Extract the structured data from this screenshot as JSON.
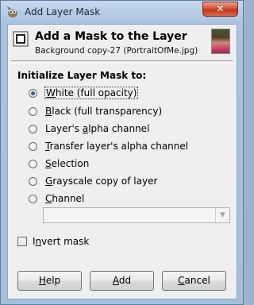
{
  "window": {
    "title": "Add Layer Mask",
    "close_label": "✕",
    "app_icon": "gimp-icon"
  },
  "header": {
    "title": "Add a Mask to the Layer",
    "subtitle": "Background copy-27 (PortraitOfMe.jpg)",
    "icon": "layer-mask-icon",
    "thumbnail": "layer-thumbnail"
  },
  "init_group": {
    "label": "Initialize Layer Mask to:",
    "options": [
      {
        "mnemonic": "W",
        "rest": "hite (full opacity)",
        "selected": true
      },
      {
        "mnemonic": "B",
        "rest": "lack (full transparency)",
        "selected": false
      },
      {
        "pre": "Layer's ",
        "mnemonic": "a",
        "rest": "lpha channel",
        "selected": false
      },
      {
        "mnemonic": "T",
        "rest": "ransfer layer's alpha channel",
        "selected": false
      },
      {
        "mnemonic": "S",
        "rest": "election",
        "selected": false
      },
      {
        "mnemonic": "G",
        "rest": "rayscale copy of layer",
        "selected": false
      },
      {
        "mnemonic": "C",
        "rest": "hannel",
        "selected": false
      }
    ],
    "channel_select": {
      "value": "",
      "enabled": false
    }
  },
  "invert": {
    "pre": "I",
    "mnemonic": "n",
    "rest": "vert mask",
    "checked": false
  },
  "buttons": {
    "help": {
      "mnemonic": "H",
      "rest": "elp"
    },
    "add": {
      "mnemonic": "A",
      "rest": "dd"
    },
    "cancel": {
      "mnemonic": "C",
      "rest": "ancel"
    }
  },
  "colors": {
    "title_bar": "#aac3e0",
    "client_bg": "#efefef",
    "close_button": "#c2341c"
  }
}
